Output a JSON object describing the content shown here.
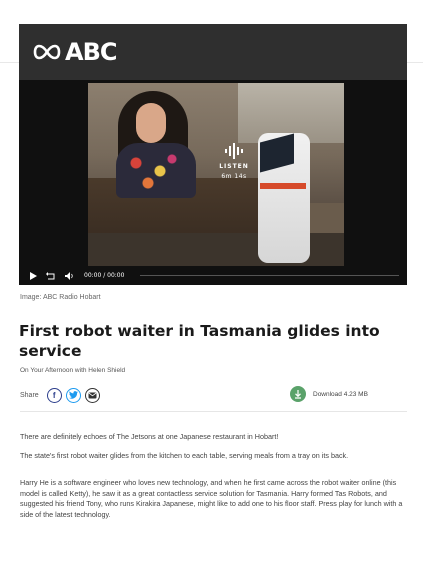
{
  "header": {
    "logo_text": "ABC",
    "logo_icon": "abc-lissajous-logo-icon",
    "background": "#2f2f2f"
  },
  "player": {
    "listen_label": "LISTEN",
    "listen_duration": "6m 14s",
    "time_display": "00:00 / 00:00",
    "play_icon": "play-icon",
    "replay_icon": "rewind-icon",
    "volume_icon": "volume-icon",
    "progress": 0
  },
  "caption": "Image: ABC Radio Hobart",
  "article": {
    "title": "First robot waiter in Tasmania glides into service",
    "program": "On Your Afternoon with Helen Shield",
    "share_label": "Share",
    "download_label": "Download 4.23 MB",
    "paragraphs": [
      "There are definitely echoes of The Jetsons at one Japanese restaurant in Hobart!",
      "The state's first robot waiter glides from the kitchen to each table, serving meals from a tray on its back.",
      "Harry He is a software engineer who loves new technology, and when he first came across the robot waiter online (this model is called Ketty), he saw it as a great contactless service solution for Tasmania. Harry formed Tas Robots, and suggested his friend Tony, who runs Kirakira Japanese, might like to add one to his floor staff. Press play for lunch with a side of the latest technology."
    ]
  },
  "colors": {
    "download_accent": "#5aa26a",
    "facebook": "#2c3e8c",
    "twitter": "#1d9bf0"
  }
}
